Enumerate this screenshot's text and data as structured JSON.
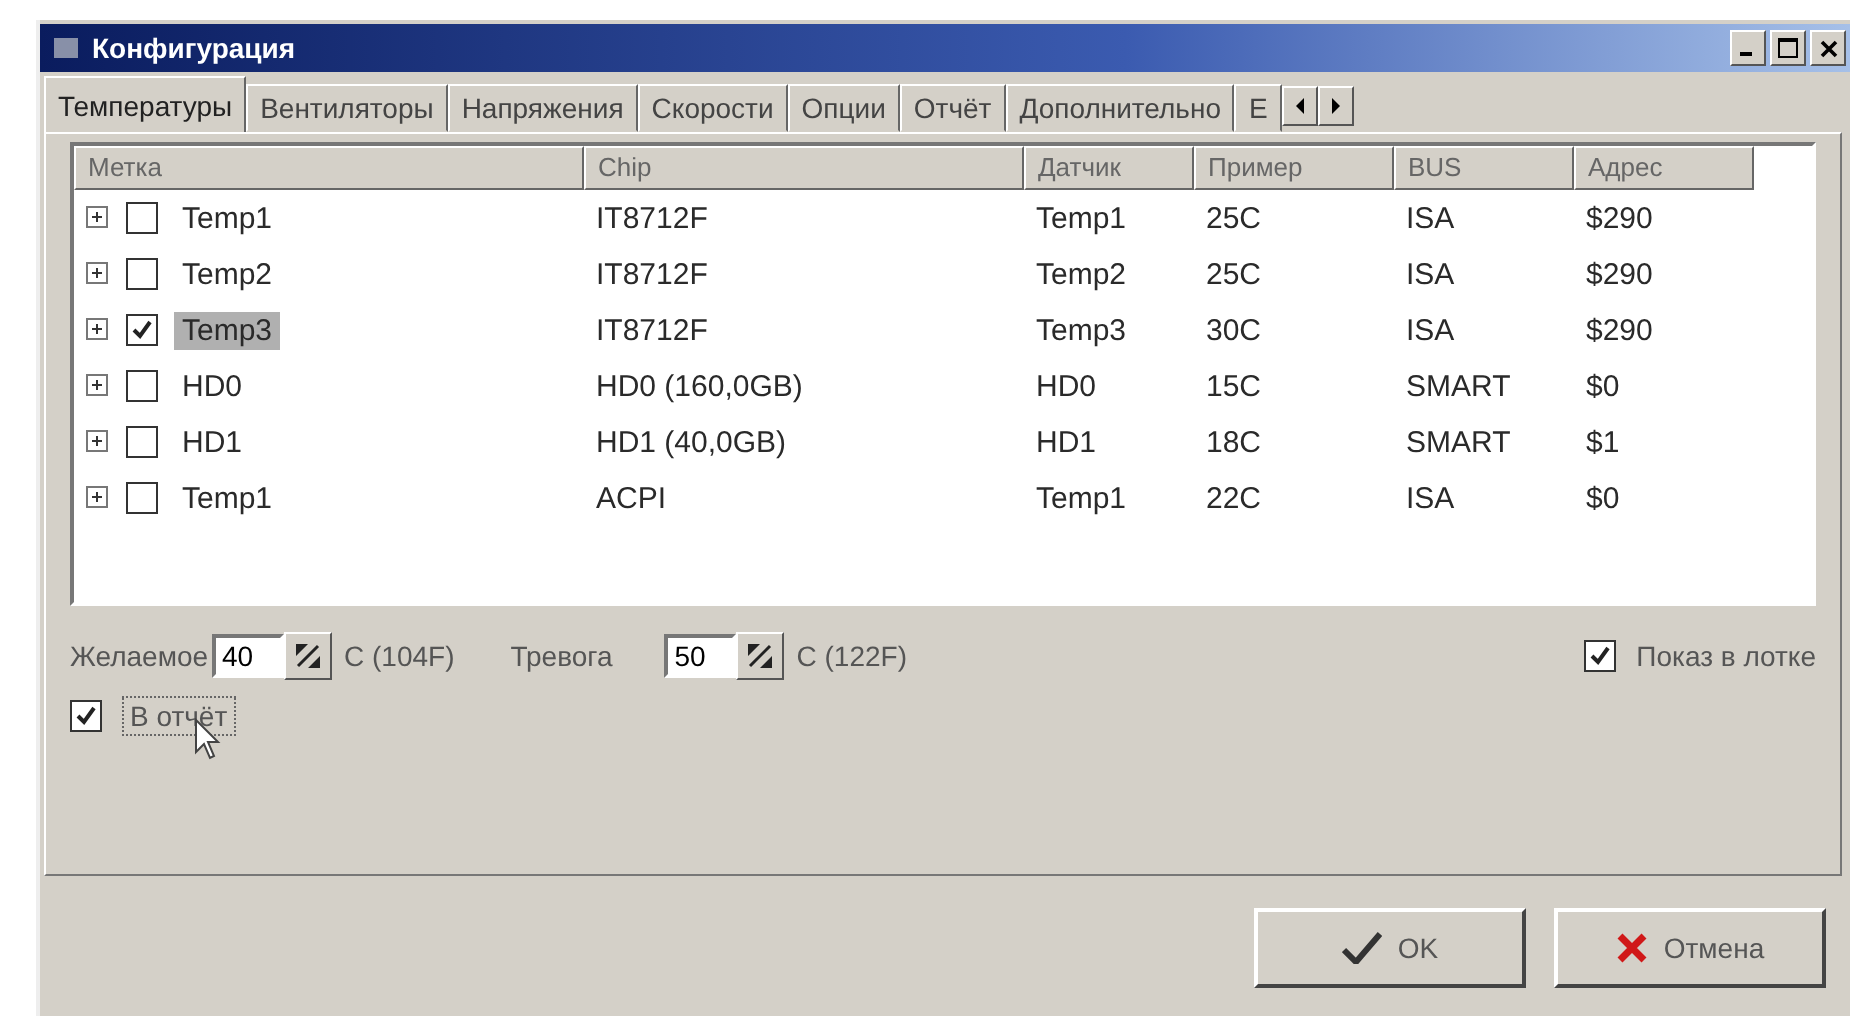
{
  "window": {
    "title": "Конфигурация"
  },
  "tabs": [
    {
      "label": "Температуры",
      "selected": true
    },
    {
      "label": "Вентиляторы",
      "selected": false
    },
    {
      "label": "Напряжения",
      "selected": false
    },
    {
      "label": "Скорости",
      "selected": false
    },
    {
      "label": "Опции",
      "selected": false
    },
    {
      "label": "Отчёт",
      "selected": false
    },
    {
      "label": "Дополнительно",
      "selected": false
    },
    {
      "label": "Е",
      "selected": false
    }
  ],
  "table": {
    "columns": [
      "Метка",
      "Chip",
      "Датчик",
      "Пример",
      "BUS",
      "Адрес"
    ],
    "rows": [
      {
        "checked": false,
        "selected": false,
        "cells": [
          "Temp1",
          "IT8712F",
          "Temp1",
          "25C",
          "ISA",
          "$290"
        ]
      },
      {
        "checked": false,
        "selected": false,
        "cells": [
          "Temp2",
          "IT8712F",
          "Temp2",
          "25C",
          "ISA",
          "$290"
        ]
      },
      {
        "checked": true,
        "selected": true,
        "cells": [
          "Temp3",
          "IT8712F",
          "Temp3",
          "30C",
          "ISA",
          "$290"
        ]
      },
      {
        "checked": false,
        "selected": false,
        "cells": [
          "HD0",
          "HD0 (160,0GB)",
          "HD0",
          "15C",
          "SMART",
          "$0"
        ]
      },
      {
        "checked": false,
        "selected": false,
        "cells": [
          "HD1",
          "HD1 (40,0GB)",
          "HD1",
          "18C",
          "SMART",
          "$1"
        ]
      },
      {
        "checked": false,
        "selected": false,
        "cells": [
          "Temp1",
          "ACPI",
          "Temp1",
          "22C",
          "ISA",
          "$0"
        ]
      }
    ]
  },
  "settings": {
    "desired_label": "Желаемое",
    "desired_value": "40",
    "desired_unit": "C (104F)",
    "alarm_label": "Тревога",
    "alarm_value": "50",
    "alarm_unit": "C (122F)",
    "tray": {
      "label": "Показ в лотке",
      "checked": true
    },
    "report": {
      "label": "В отчёт",
      "checked": true
    }
  },
  "buttons": [
    {
      "label": "OK",
      "kind": "ok"
    },
    {
      "label": "Отмена",
      "kind": "cancel"
    }
  ]
}
